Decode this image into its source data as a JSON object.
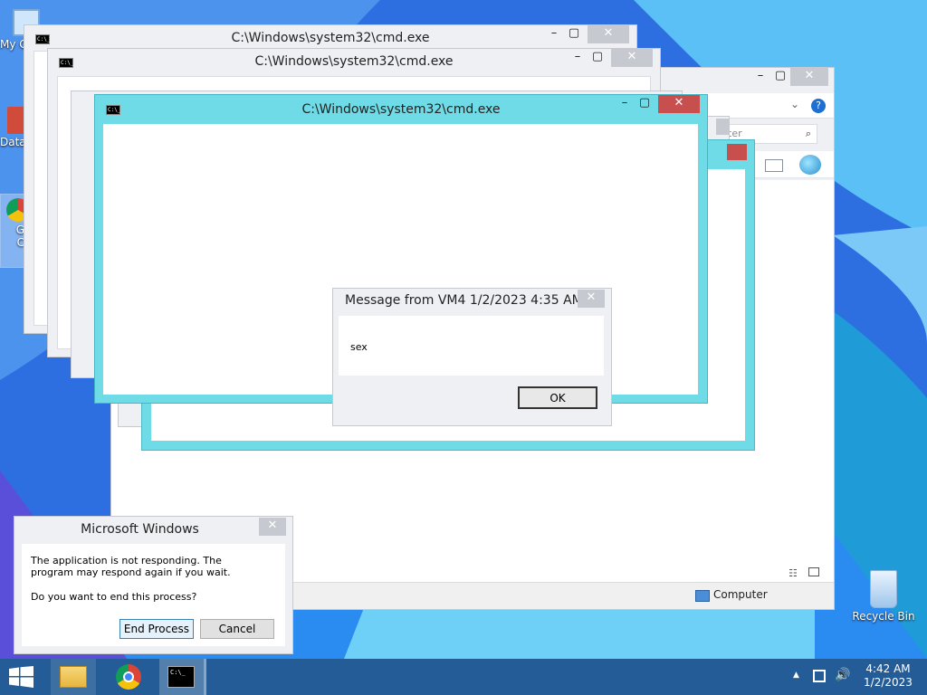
{
  "desktop": {
    "icons": [
      {
        "label": "My C",
        "icon": "computer-icon"
      },
      {
        "label": "Data",
        "icon": "shortcut-icon"
      },
      {
        "label": "G\nC",
        "icon": "chrome-icon"
      },
      {
        "label": "Recycle Bin",
        "icon": "recycle-bin-icon"
      }
    ]
  },
  "cmd_windows": [
    {
      "title": "C:\\Windows\\system32\\cmd.exe"
    },
    {
      "title": "C:\\Windows\\system32\\cmd.exe"
    },
    {
      "title": "C:\\Windows\\system32\\cmd.exe"
    }
  ],
  "explorer": {
    "search_placeholder": "ter",
    "status_computer": "Computer"
  },
  "message_dialog": {
    "title": "Message from VM4 1/2/2023 4:35 AM",
    "body": "sex",
    "ok_label": "OK"
  },
  "not_responding_dialog": {
    "title": "Microsoft Windows",
    "line1": "The application is not responding. The program may respond again if you wait.",
    "line2": "Do you want to end this process?",
    "end_process_label": "End Process",
    "cancel_label": "Cancel"
  },
  "taskbar": {
    "time": "4:42 AM",
    "date": "1/2/2023"
  },
  "colors": {
    "active_frame": "#6fdbe6",
    "close_red": "#c7504f",
    "taskbar": "#235c96"
  }
}
